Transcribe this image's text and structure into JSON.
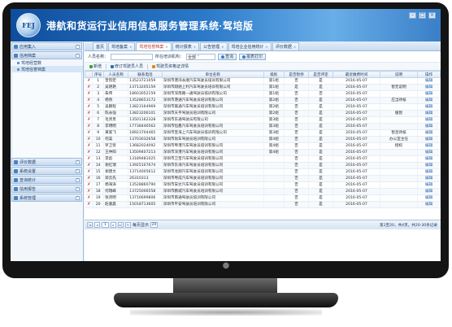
{
  "app": {
    "logo_text": "FEJ",
    "title": "港航和货运行业信用信息服务管理系统·驾培版"
  },
  "header_buttons": [
    "–",
    "□",
    "×"
  ],
  "sidebar": {
    "sections_top": [
      {
        "label": "应用集入",
        "icon": "folder-icon"
      },
      {
        "label": "信用档案",
        "icon": "folder-icon"
      }
    ],
    "sub_items": [
      {
        "label": "驾培经营数",
        "active": false
      },
      {
        "label": "驾培信誉档案",
        "active": true
      }
    ],
    "sections_bottom": [
      {
        "label": "评价数据",
        "icon": "folder-icon"
      },
      {
        "label": "系统设置",
        "icon": "folder-icon"
      },
      {
        "label": "查询统计",
        "icon": "folder-icon"
      },
      {
        "label": "信用报告",
        "icon": "folder-icon"
      },
      {
        "label": "系统管理",
        "icon": "folder-icon"
      }
    ]
  },
  "tabs": [
    {
      "label": "首页",
      "active": false
    },
    {
      "label": "驾培备案",
      "active": false
    },
    {
      "label": "驾培信誉档案",
      "active": true
    },
    {
      "label": "统计报表",
      "active": false
    },
    {
      "label": "公告管理",
      "active": false
    },
    {
      "label": "驾培企业信用统计",
      "active": false
    },
    {
      "label": "评价数据",
      "active": false
    }
  ],
  "search": {
    "name_label": "人员名称：",
    "name_value": "",
    "level_label": "所在培训机构：",
    "level_value": "全部",
    "query_label": "查询",
    "export_label": "报表打印"
  },
  "toolbar": {
    "add_label": "新增",
    "edit_label": "修订驾驶员人员",
    "record_label": "驾驶员资格证详情"
  },
  "table": {
    "columns": [
      "",
      "序号",
      "人员名称",
      "联系电话",
      "单位名称",
      "级别",
      "是否暂停",
      "是否评定",
      "最近缴费时间",
      "说明",
      "操作"
    ],
    "rows": [
      [
        "1",
        "曾凯宏",
        "13523721059",
        "深圳市港湾永顺汽车驾驶员培训有限公司",
        "第1组",
        "否",
        "是",
        "2016-05-07",
        "",
        "编辑"
      ],
      [
        "2",
        "吴艳艳",
        "13713205159",
        "深圳市翔驰上利汽车驾驶员培训有限公司",
        "第1组",
        "是",
        "是",
        "2016-05-07",
        "暂无说明",
        "编辑"
      ],
      [
        "3",
        "朱伟",
        "18603052159",
        "深圳市深南路一通驾驶员培训有限公司",
        "第1组",
        "否",
        "否",
        "2016-05-07",
        "",
        "编辑"
      ],
      [
        "4",
        "杨燕",
        "13528653172",
        "深圳市港通汽车驾驶员培训有限公司",
        "第2组",
        "否",
        "是",
        "2016-05-07",
        "应当待核",
        "编辑"
      ],
      [
        "5",
        "吴鹏程",
        "13823164969",
        "深圳市嘉通汽车驾驶员培训有限公司",
        "第2组",
        "否",
        "是",
        "2016-05-07",
        "",
        "编辑"
      ],
      [
        "6",
        "陈永强",
        "13823206101",
        "深圳市天平驾驶员培训有限公司",
        "第2组",
        "否",
        "是",
        "2016-05-07",
        "缓暂",
        "编辑"
      ],
      [
        "7",
        "毛贤贵",
        "13501162328",
        "深圳市东通驾驶员有限公司",
        "第3组",
        "否",
        "是",
        "2016-05-07",
        "",
        "编辑"
      ],
      [
        "8",
        "李明明",
        "17738446562",
        "深圳市恒鑫汽车驾驶员培训有限公司",
        "第3组",
        "否",
        "是",
        "2016-05-07",
        "",
        "编辑"
      ],
      [
        "9",
        "黄家飞",
        "18923704465",
        "深圳市宝海上汽车驾驶员培训有限公司",
        "第3组",
        "否",
        "是",
        "2016-05-07",
        "暂且待核",
        "编辑"
      ],
      [
        "10",
        "何美",
        "13703032658",
        "深圳市尚车驾驶员培训有限公司",
        "第4组",
        "否",
        "是",
        "2016-05-07",
        "办公室主任",
        "编辑"
      ],
      [
        "11",
        "罗卫贤",
        "13682024092",
        "深圳市粤港汽车驾驶员培训有限公司",
        "第4组",
        "否",
        "是",
        "2016-05-07",
        "授权",
        "编辑"
      ],
      [
        "12",
        "王仲阳",
        "13509407213",
        "深圳市深港汽车驾驶员培训有限公司",
        "第4组",
        "否",
        "是",
        "2016-05-07",
        "",
        "编辑"
      ],
      [
        "13",
        "李彪",
        "13189481025",
        "深圳市卫宝汽车驾驶员培训有限公司",
        "",
        "否",
        "是",
        "2016-05-07",
        "",
        "编辑"
      ],
      [
        "14",
        "谢红瑞",
        "13925107674",
        "深圳市东海汽车驾驶员培训有限公司",
        "",
        "否",
        "是",
        "2016-05-07",
        "",
        "编辑"
      ],
      [
        "15",
        "谢建文",
        "13714005612",
        "深圳市龙翔汽车驾驶员培训有限公司",
        "",
        "否",
        "是",
        "2016-05-07",
        "",
        "编辑"
      ],
      [
        "16",
        "梁云先",
        "26310313",
        "深圳市粤成汽车驾驶员培训有限公司",
        "",
        "否",
        "是",
        "2016-05-07",
        "",
        "编辑"
      ],
      [
        "17",
        "杨海涛",
        "13528860790",
        "深圳市安达汽车驾驶员培训有限公司",
        "",
        "否",
        "是",
        "2016-05-07",
        "",
        "编辑"
      ],
      [
        "18",
        "何瑞峰",
        "13725006558",
        "深圳市鹏城汽车驾驶员培训有限公司",
        "",
        "否",
        "是",
        "2016-05-07",
        "",
        "编辑"
      ],
      [
        "19",
        "张贤明",
        "13716699806",
        "深圳市南通驾驶员培训有限公司",
        "",
        "否",
        "是",
        "2016-05-07",
        "",
        "编辑"
      ],
      [
        "20",
        "赵嘉晨",
        "15018713605",
        "深圳市平安驾驶员培训有限公司",
        "",
        "否",
        "是",
        "2016-05-07",
        "",
        "编辑"
      ]
    ]
  },
  "pager": {
    "current_page": "1",
    "page_size_label": "每页显示",
    "page_size": "20",
    "info": "第1至20，共4页，共20-30条记录"
  }
}
